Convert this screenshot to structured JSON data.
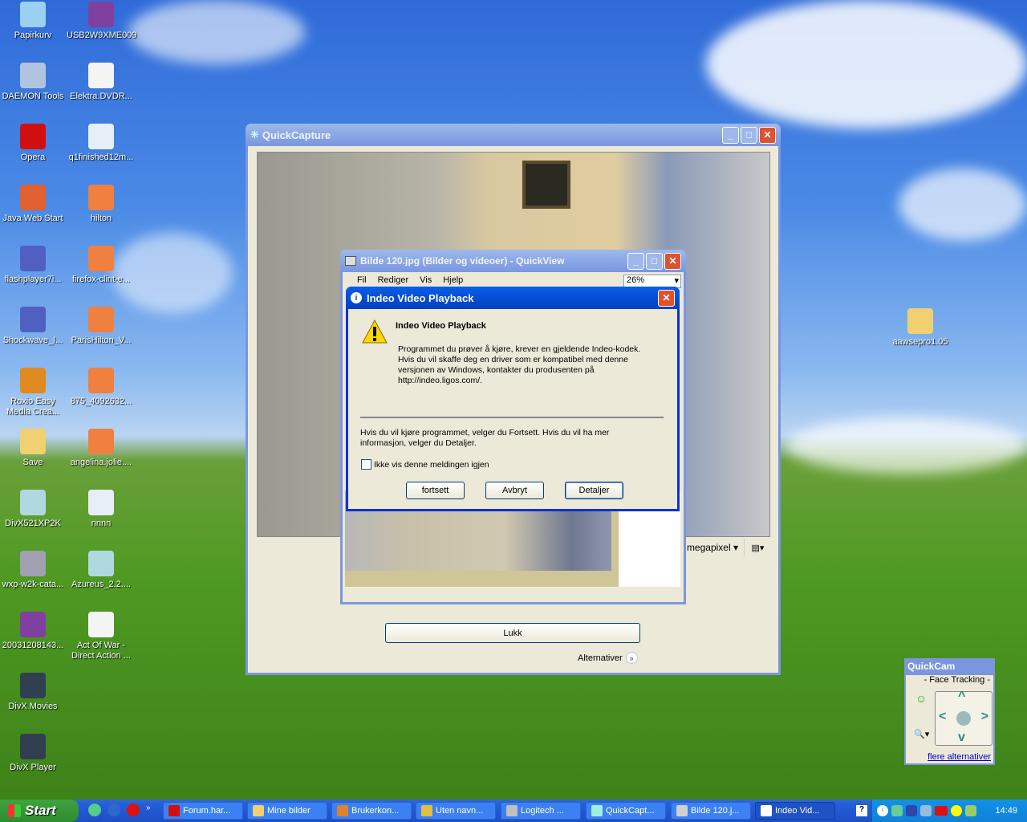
{
  "desktop": {
    "icons_left": [
      {
        "label": "Papirkurv",
        "color": "#9ad0f0"
      },
      {
        "label": "DAEMON Tools",
        "color": "#b0c4e0"
      },
      {
        "label": "Opera",
        "color": "#d01010"
      },
      {
        "label": "Java Web Start",
        "color": "#e06030"
      },
      {
        "label": "flashplayer7i...",
        "color": "#5060c0"
      },
      {
        "label": "Shockwave_I...",
        "color": "#5060c0"
      },
      {
        "label": "Roxio Easy Media Crea...",
        "color": "#e08a20"
      },
      {
        "label": "Save",
        "color": "#f0d070"
      },
      {
        "label": "DivX521XP2K",
        "color": "#b0d8e0"
      },
      {
        "label": "wxp-w2k-cata...",
        "color": "#a0a0b0"
      },
      {
        "label": "20031208143...",
        "color": "#8040a0"
      },
      {
        "label": "DivX Movies",
        "color": "#304050"
      },
      {
        "label": "DivX Player",
        "color": "#304050"
      }
    ],
    "icons_right": [
      {
        "label": "USB2W9XME009",
        "color": "#8040a0"
      },
      {
        "label": "Elektra.DVDR...",
        "color": "#f4f4f4"
      },
      {
        "label": "q1finished12m...",
        "color": "#e8eef8"
      },
      {
        "label": "hilton",
        "color": "#f08040"
      },
      {
        "label": "firefox-clint-e...",
        "color": "#f08040"
      },
      {
        "label": "ParisHilton_V...",
        "color": "#f08040"
      },
      {
        "label": "875_4092632...",
        "color": "#f08040"
      },
      {
        "label": "angelina.jolie....",
        "color": "#f08040"
      },
      {
        "label": "nnnn",
        "color": "#e8eef8"
      },
      {
        "label": "Azureus_2.2....",
        "color": "#b0d8e0"
      },
      {
        "label": "Act Of War - Direct Action ...",
        "color": "#f4f4f4"
      }
    ],
    "icon_far": {
      "label": "aawsepro1.05",
      "color": "#f0d070"
    }
  },
  "quickcapture": {
    "title": "QuickCapture",
    "resolution": "megapixel",
    "close_button": "Lukk",
    "options_link": "Alternativer"
  },
  "quickview": {
    "title": "Bilde 120.jpg (Bilder og videoer) - QuickView",
    "menu": [
      "Fil",
      "Rediger",
      "Vis",
      "Hjelp"
    ],
    "zoom": "26%"
  },
  "dialog": {
    "title": "Indeo Video Playback",
    "heading": "Indeo Video Playback",
    "message_lines": [
      "Programmet du prøver å kjøre, krever en gjeldende Indeo-kodek.",
      "Hvis du vil skaffe deg en driver som er kompatibel med denne",
      "versjonen av Windows, kontakter du produsenten på",
      "http://indeo.ligos.com/."
    ],
    "instruction_lines": [
      "Hvis du vil kjøre programmet, velger du Fortsett. Hvis du vil ha mer",
      "informasjon, velger du Detaljer."
    ],
    "checkbox_label": "Ikke vis denne meldingen igjen",
    "checkbox_checked": false,
    "buttons": {
      "continue": "fortsett",
      "cancel": "Avbryt",
      "details": "Detaljer"
    }
  },
  "quickcam": {
    "title": "QuickCam",
    "section": "- Face Tracking -",
    "link": "flere alternativer"
  },
  "taskbar": {
    "start": "Start",
    "tasks": [
      {
        "label": "Forum.har...",
        "color": "#d01010"
      },
      {
        "label": "Mine bilder",
        "color": "#f0d070"
      },
      {
        "label": "Brukerkon...",
        "color": "#e08030"
      },
      {
        "label": "Uten navn...",
        "color": "#e0c040"
      },
      {
        "label": "Logitech ...",
        "color": "#c0c0c0"
      },
      {
        "label": "QuickCapt...",
        "color": "#9ff0e0"
      },
      {
        "label": "Bilde 120.j...",
        "color": "#d0d0d0"
      },
      {
        "label": "Indeo Vid...",
        "color": "#ffffff",
        "active": true
      }
    ],
    "clock": "14:49"
  }
}
